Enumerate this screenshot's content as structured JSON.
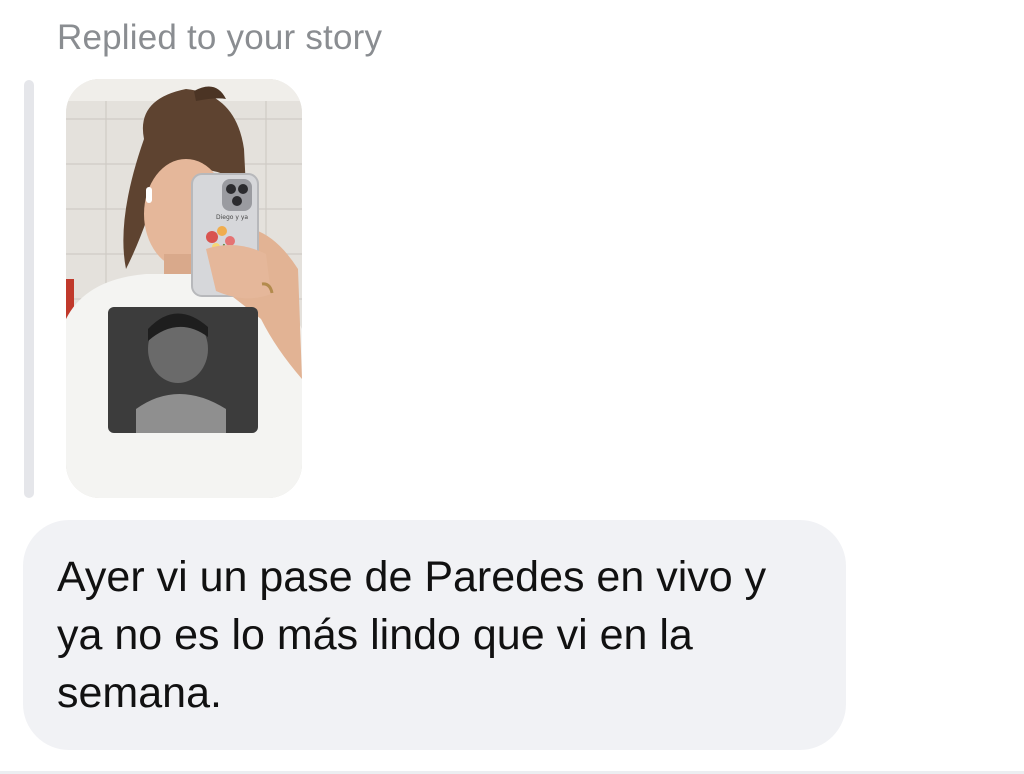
{
  "reply": {
    "caption": "Replied to your story"
  },
  "story": {
    "phone_case_text": "Diego y ya",
    "colors": {
      "tiles": "#dedbd6",
      "shirt": "#f4f4f2",
      "print": "#3c3c3c",
      "hair": "#5e4330",
      "skin": "#e5b79a"
    }
  },
  "message": {
    "text": "Ayer vi un pase de Paredes en vivo y ya no es lo más lindo que vi en la semana."
  },
  "theme": {
    "bubble_bg": "#f1f2f5",
    "caption_color": "#8a8d91",
    "text_color": "#111111"
  }
}
